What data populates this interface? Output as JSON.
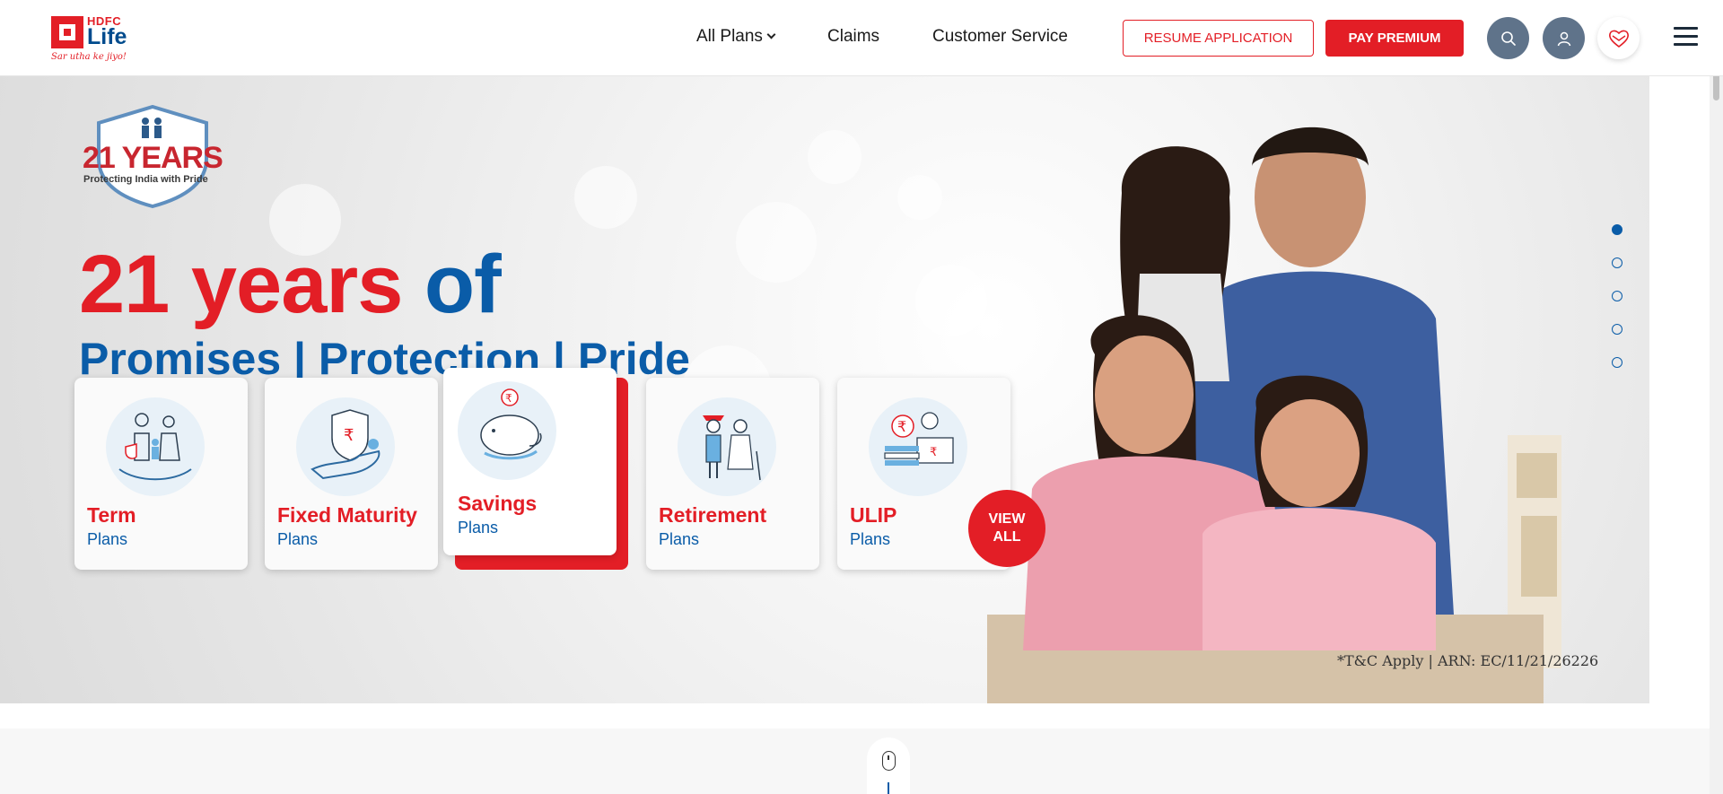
{
  "header": {
    "logo": {
      "brand_top": "HDFC",
      "brand_main": "Life",
      "tagline": "Sar utha ke jiyo!"
    },
    "nav": {
      "all_plans": "All Plans",
      "claims": "Claims",
      "customer_service": "Customer Service"
    },
    "resume_label": "RESUME APPLICATION",
    "pay_label": "PAY PREMIUM",
    "icons": [
      "search-icon",
      "user-icon",
      "heart-icon",
      "menu-icon"
    ]
  },
  "hero": {
    "badge": {
      "years": "21 YEARS",
      "tagline": "Protecting India with Pride"
    },
    "headline_red": "21 years",
    "headline_blue": "of",
    "subheadline": "Promises | Protection | Pride",
    "disclaimer": "*T&C Apply | ARN: EC/11/21/26226",
    "slides": {
      "count": 5,
      "active_index": 0
    }
  },
  "plans": [
    {
      "title": "Term",
      "sub": "Plans",
      "icon": "family-protection-icon"
    },
    {
      "title": "Fixed Maturity",
      "sub": "Plans",
      "icon": "rupee-shield-icon"
    },
    {
      "title": "Savings",
      "sub": "Plans",
      "icon": "piggy-bank-icon"
    },
    {
      "title": "Retirement",
      "sub": "Plans",
      "icon": "elderly-couple-icon"
    },
    {
      "title": "ULIP",
      "sub": "Plans",
      "icon": "coin-stack-icon"
    }
  ],
  "view_all": {
    "line1": "VIEW",
    "line2": "ALL"
  },
  "colors": {
    "brand_red": "#e31e26",
    "brand_blue": "#0a5ca8",
    "icon_button": "#5f738a"
  }
}
